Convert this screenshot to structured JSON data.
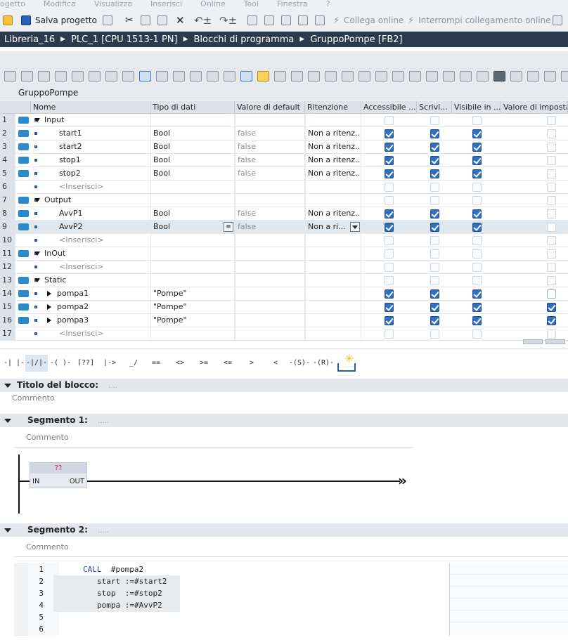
{
  "menu": [
    "ogetto",
    "Modifica",
    "Visualizza",
    "Inserisci",
    "Online",
    "Tool",
    "Finestra",
    "?"
  ],
  "toolbar": {
    "save_label": "Salva progetto",
    "connect_label": "Collega online",
    "disconnect_label": "Interrompi collegamento online"
  },
  "breadcrumb": [
    "Libreria_16",
    "PLC_1 [CPU 1513-1 PN]",
    "Blocchi di programma",
    "GruppoPompe [FB2]"
  ],
  "block_name": "GruppoPompe",
  "table": {
    "headers": [
      "Nome",
      "Tipo di dati",
      "Valore di default",
      "Ritenzione",
      "Accessibile ...",
      "Scrivi...",
      "Visibile in ...",
      "Valore di imposta"
    ],
    "rows": [
      {
        "n": "1",
        "name": "Input",
        "type": "",
        "def": "",
        "ret": "",
        "level": 0,
        "expand": "down",
        "io": true,
        "acc": "dim",
        "wr": "dim",
        "vis": "dim",
        "set": "dim"
      },
      {
        "n": "2",
        "name": "start1",
        "type": "Bool",
        "def": "false",
        "ret": "Non a ritenz...",
        "level": 1,
        "expand": "",
        "io": true,
        "acc": "on",
        "wr": "on",
        "vis": "on",
        "set": "dim"
      },
      {
        "n": "3",
        "name": "start2",
        "type": "Bool",
        "def": "false",
        "ret": "Non a ritenz...",
        "level": 1,
        "expand": "",
        "io": true,
        "acc": "on",
        "wr": "on",
        "vis": "on",
        "set": "dim"
      },
      {
        "n": "4",
        "name": "stop1",
        "type": "Bool",
        "def": "false",
        "ret": "Non a ritenz...",
        "level": 1,
        "expand": "",
        "io": true,
        "acc": "on",
        "wr": "on",
        "vis": "on",
        "set": "dim"
      },
      {
        "n": "5",
        "name": "stop2",
        "type": "Bool",
        "def": "false",
        "ret": "Non a ritenz...",
        "level": 1,
        "expand": "",
        "io": true,
        "acc": "on",
        "wr": "on",
        "vis": "on",
        "set": "dim"
      },
      {
        "n": "6",
        "name": "<Inserisci>",
        "type": "",
        "def": "",
        "ret": "",
        "level": 1,
        "expand": "",
        "io": false,
        "acc": "dim",
        "wr": "dim",
        "vis": "dim",
        "set": "dim"
      },
      {
        "n": "7",
        "name": "Output",
        "type": "",
        "def": "",
        "ret": "",
        "level": 0,
        "expand": "down",
        "io": true,
        "acc": "dim",
        "wr": "dim",
        "vis": "dim",
        "set": "dim"
      },
      {
        "n": "8",
        "name": "AvvP1",
        "type": "Bool",
        "def": "false",
        "ret": "Non a ritenz...",
        "level": 1,
        "expand": "",
        "io": true,
        "acc": "on",
        "wr": "on",
        "vis": "on",
        "set": "dim"
      },
      {
        "n": "9",
        "name": "AvvP2",
        "type": "Bool",
        "def": "false",
        "ret": "Non a ri...",
        "level": 1,
        "expand": "",
        "io": true,
        "acc": "on",
        "wr": "on",
        "vis": "on",
        "set": "dim",
        "selected": true
      },
      {
        "n": "10",
        "name": "<Inserisci>",
        "type": "",
        "def": "",
        "ret": "",
        "level": 1,
        "expand": "",
        "io": false,
        "acc": "dim",
        "wr": "dim",
        "vis": "dim",
        "set": "dim"
      },
      {
        "n": "11",
        "name": "InOut",
        "type": "",
        "def": "",
        "ret": "",
        "level": 0,
        "expand": "down",
        "io": true,
        "acc": "dim",
        "wr": "dim",
        "vis": "dim",
        "set": "dim"
      },
      {
        "n": "12",
        "name": "<Inserisci>",
        "type": "",
        "def": "",
        "ret": "",
        "level": 1,
        "expand": "",
        "io": false,
        "acc": "dim",
        "wr": "dim",
        "vis": "dim",
        "set": "dim"
      },
      {
        "n": "13",
        "name": "Static",
        "type": "",
        "def": "",
        "ret": "",
        "level": 0,
        "expand": "down",
        "io": true,
        "acc": "dim",
        "wr": "dim",
        "vis": "dim",
        "set": "dim"
      },
      {
        "n": "14",
        "name": "pompa1",
        "type": "\"Pompe\"",
        "def": "",
        "ret": "",
        "level": 1,
        "expand": "right",
        "io": true,
        "acc": "on",
        "wr": "on",
        "vis": "on",
        "set": "off"
      },
      {
        "n": "15",
        "name": "pompa2",
        "type": "\"Pompe\"",
        "def": "",
        "ret": "",
        "level": 1,
        "expand": "right",
        "io": true,
        "acc": "on",
        "wr": "on",
        "vis": "on",
        "set": "on"
      },
      {
        "n": "16",
        "name": "pompa3",
        "type": "\"Pompe\"",
        "def": "",
        "ret": "",
        "level": 1,
        "expand": "right",
        "io": true,
        "acc": "on",
        "wr": "on",
        "vis": "on",
        "set": "on"
      },
      {
        "n": "17",
        "name": "<Inserisci>",
        "type": "",
        "def": "",
        "ret": "",
        "level": 1,
        "expand": "",
        "io": false,
        "acc": "dim",
        "wr": "dim",
        "vis": "dim",
        "set": "dim"
      }
    ]
  },
  "ladder_palette": [
    "-| |-",
    "-|/|-",
    "-( )-",
    "[??]",
    "|->",
    "_/",
    "==",
    "<>",
    ">=",
    "<=",
    ">",
    "<",
    "-(S)-",
    "-(R)-"
  ],
  "block_title": {
    "label": "Titolo del blocco:",
    "dots": "....",
    "comment": "Commento"
  },
  "segment1": {
    "label": "Segmento 1:",
    "dots": ".....",
    "comment": "Commento",
    "box_name": "??",
    "in_label": "IN",
    "out_label": "OUT",
    "arrow": "»"
  },
  "segment2": {
    "label": "Segmento 2:",
    "dots": ".....",
    "comment": "Commento",
    "lines": [
      {
        "n": "1",
        "text": "CALL  #pompa2"
      },
      {
        "n": "2",
        "text": "start :=#start2"
      },
      {
        "n": "3",
        "text": "stop  :=#stop2"
      },
      {
        "n": "4",
        "text": "pompa :=#AvvP2"
      },
      {
        "n": "5",
        "text": ""
      },
      {
        "n": "6",
        "text": ""
      }
    ]
  }
}
